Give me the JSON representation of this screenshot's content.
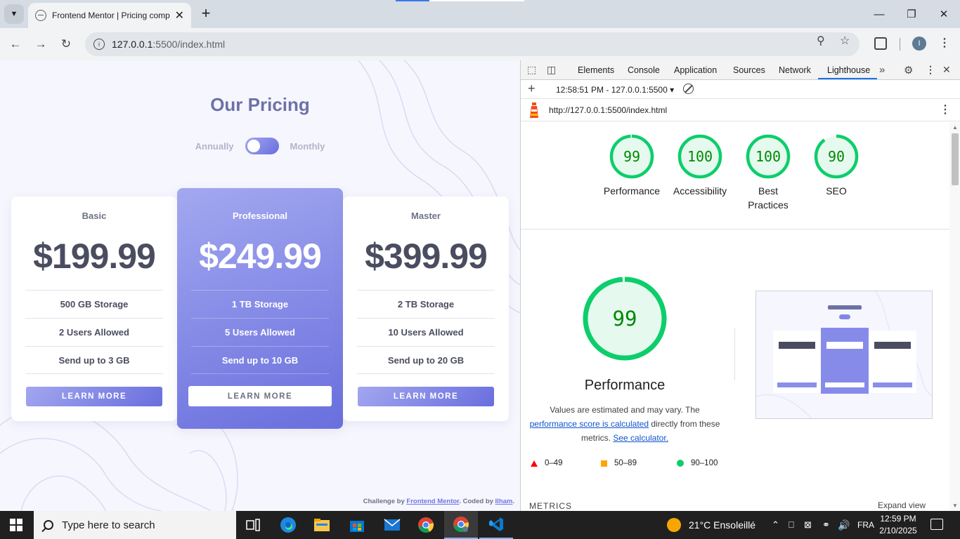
{
  "browser": {
    "tab_title": "Frontend Mentor | Pricing comp",
    "url_host": "127.0.0.1",
    "url_rest": ":5500/index.html",
    "profile_initial": "I"
  },
  "page": {
    "title": "Our Pricing",
    "toggle": {
      "left": "Annually",
      "right": "Monthly"
    },
    "plans": [
      {
        "name": "Basic",
        "price": "$199.99",
        "features": [
          "500 GB Storage",
          "2 Users Allowed",
          "Send up to 3 GB"
        ],
        "button": "LEARN MORE"
      },
      {
        "name": "Professional",
        "price": "$249.99",
        "features": [
          "1 TB Storage",
          "5 Users Allowed",
          "Send up to 10 GB"
        ],
        "button": "LEARN MORE"
      },
      {
        "name": "Master",
        "price": "$399.99",
        "features": [
          "2 TB Storage",
          "10 Users Allowed",
          "Send up to 20 GB"
        ],
        "button": "LEARN MORE"
      }
    ],
    "attribution": {
      "prefix": "Challenge by ",
      "link1": "Frontend Mentor",
      "middle": ". Coded by ",
      "link2": "Ilham",
      "suffix": "."
    }
  },
  "devtools": {
    "tabs": [
      "Elements",
      "Console",
      "Application",
      "Sources",
      "Network",
      "Lighthouse"
    ],
    "active_tab": "Lighthouse",
    "report_label": "12:58:51 PM - 127.0.0.1:5500",
    "page_url": "http://127.0.0.1:5500/index.html",
    "scores": [
      {
        "label": "Performance",
        "value": 99
      },
      {
        "label": "Accessibility",
        "value": 100
      },
      {
        "label": "Best Practices",
        "value": 100
      },
      {
        "label": "SEO",
        "value": 90
      }
    ],
    "main": {
      "value": 99,
      "title": "Performance",
      "desc1": "Values are estimated and may vary. The",
      "link1": "performance score is calculated",
      "desc2": " directly from these metrics. ",
      "link2": "See calculator."
    },
    "legend": [
      "0–49",
      "50–89",
      "90–100"
    ],
    "metrics_label": "METRICS",
    "expand_label": "Expand view",
    "colors": {
      "pass": "#0cce6b",
      "pass_fill": "#e6f9ef",
      "pass_text": "#008800"
    }
  },
  "taskbar": {
    "search_placeholder": "Type here to search",
    "weather": "21°C  Ensoleillé",
    "lang": "FRA",
    "time": "12:59 PM",
    "date": "2/10/2025"
  }
}
